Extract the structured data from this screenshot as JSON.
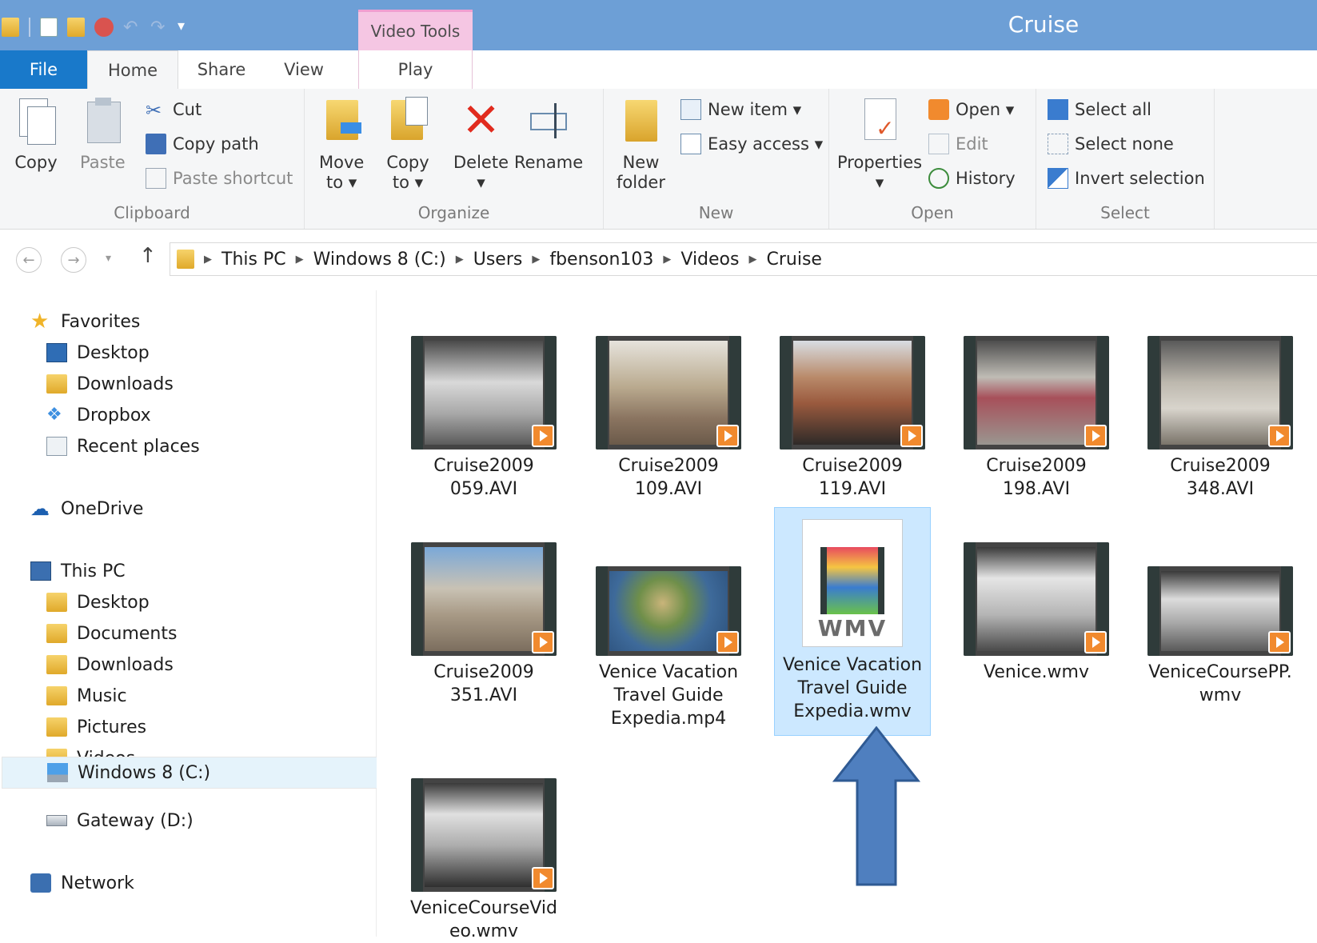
{
  "window": {
    "title": "Cruise",
    "context_tab": "Video Tools"
  },
  "tabs": {
    "file": "File",
    "home": "Home",
    "share": "Share",
    "view": "View",
    "play": "Play"
  },
  "ribbon": {
    "clipboard": {
      "label": "Clipboard",
      "copy": "Copy",
      "paste": "Paste",
      "cut": "Cut",
      "copy_path": "Copy path",
      "paste_shortcut": "Paste shortcut"
    },
    "organize": {
      "label": "Organize",
      "move_to_1": "Move",
      "move_to_2": "to ▾",
      "copy_to_1": "Copy",
      "copy_to_2": "to ▾",
      "delete_1": "Delete",
      "delete_2": "▾",
      "rename": "Rename"
    },
    "new": {
      "label": "New",
      "new_folder_1": "New",
      "new_folder_2": "folder",
      "new_item": "New item ▾",
      "easy_access": "Easy access ▾"
    },
    "open": {
      "label": "Open",
      "properties_1": "Properties",
      "properties_2": "▾",
      "open": "Open ▾",
      "edit": "Edit",
      "history": "History"
    },
    "select": {
      "label": "Select",
      "select_all": "Select all",
      "select_none": "Select none",
      "invert_selection": "Invert selection"
    }
  },
  "address": {
    "crumbs": [
      "This PC",
      "Windows 8 (C:)",
      "Users",
      "fbenson103",
      "Videos",
      "Cruise"
    ]
  },
  "nav": {
    "favorites": "Favorites",
    "fav_desktop": "Desktop",
    "fav_downloads": "Downloads",
    "fav_dropbox": "Dropbox",
    "fav_recent": "Recent places",
    "onedrive": "OneDrive",
    "this_pc": "This PC",
    "pc_desktop": "Desktop",
    "pc_documents": "Documents",
    "pc_downloads": "Downloads",
    "pc_music": "Music",
    "pc_pictures": "Pictures",
    "pc_videos": "Videos",
    "pc_windows8": "Windows 8 (C:)",
    "pc_gateway": "Gateway (D:)",
    "network": "Network"
  },
  "files": [
    {
      "line1": "Cruise2009",
      "line2": "059.AVI",
      "line3": ""
    },
    {
      "line1": "Cruise2009",
      "line2": "109.AVI",
      "line3": ""
    },
    {
      "line1": "Cruise2009",
      "line2": "119.AVI",
      "line3": ""
    },
    {
      "line1": "Cruise2009",
      "line2": "198.AVI",
      "line3": ""
    },
    {
      "line1": "Cruise2009",
      "line2": "348.AVI",
      "line3": ""
    },
    {
      "line1": "Cruise2009",
      "line2": "351.AVI",
      "line3": ""
    },
    {
      "line1": "Venice Vacation",
      "line2": "Travel Guide",
      "line3": "Expedia.mp4"
    },
    {
      "line1": "Venice Vacation",
      "line2": "Travel Guide",
      "line3": "Expedia.wmv",
      "badge": "WMV"
    },
    {
      "line1": "Venice.wmv",
      "line2": "",
      "line3": ""
    },
    {
      "line1": "VeniceCoursePP.",
      "line2": "wmv",
      "line3": ""
    },
    {
      "line1": "VeniceCourseVid",
      "line2": "eo.wmv",
      "line3": ""
    }
  ],
  "colors": {
    "titlebar": "#6d9fd6",
    "file_tab": "#1979ca",
    "context_tab": "#f5c6e3",
    "selection": "#cce8ff",
    "arrow": "#4f7fbf"
  }
}
